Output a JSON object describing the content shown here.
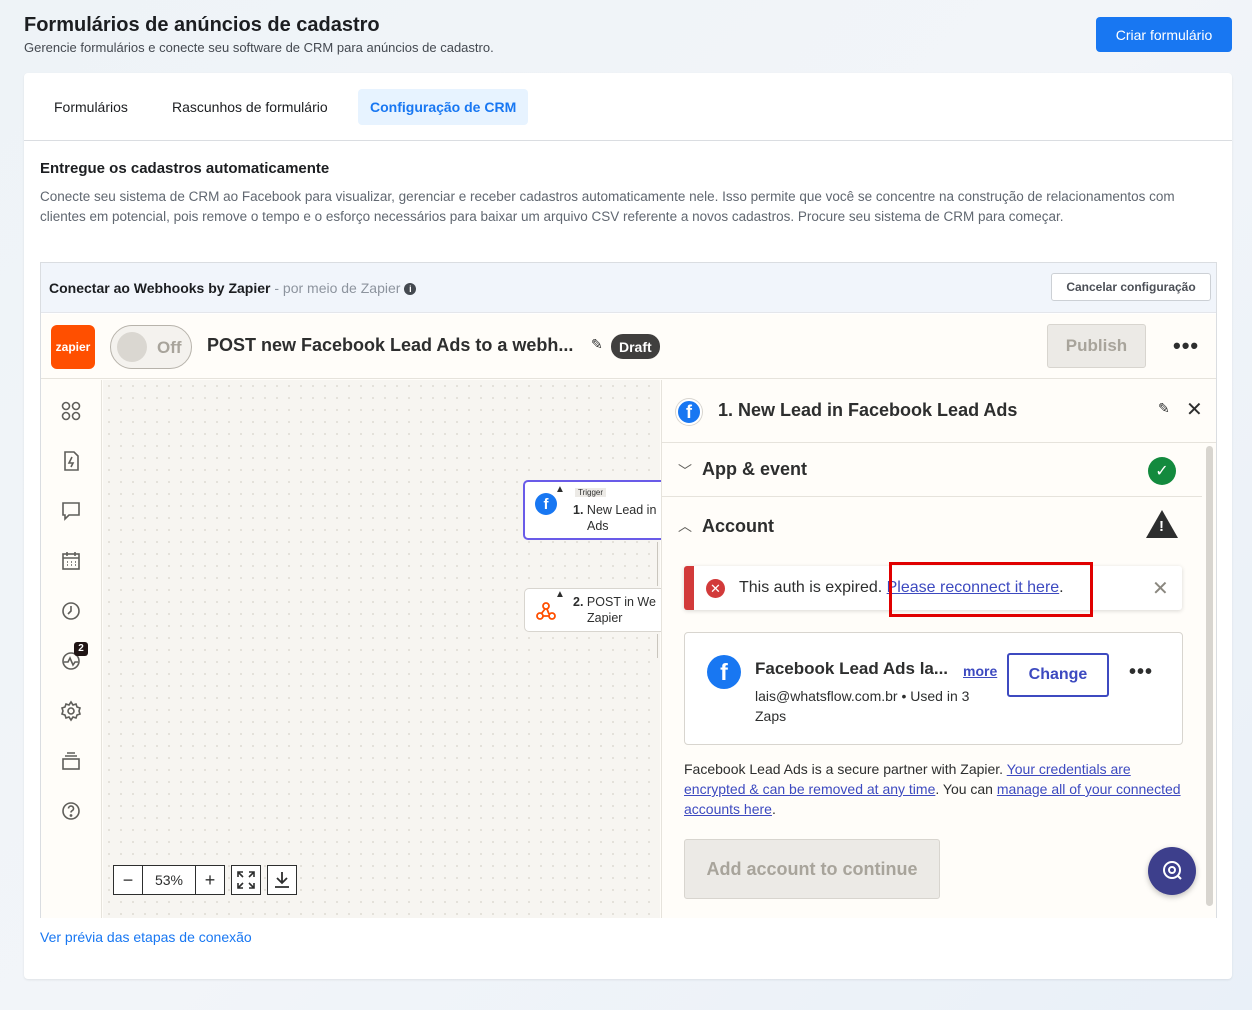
{
  "header": {
    "title": "Formulários de anúncios de cadastro",
    "subtitle": "Gerencie formulários e conecte seu software de CRM para anúncios de cadastro.",
    "create_button": "Criar formulário"
  },
  "tabs": [
    {
      "label": "Formulários"
    },
    {
      "label": "Rascunhos de formulário"
    },
    {
      "label": "Configuração de CRM"
    }
  ],
  "section": {
    "title": "Entregue os cadastros automaticamente",
    "description": "Conecte seu sistema de CRM ao Facebook para visualizar, gerenciar e receber cadastros automaticamente nele. Isso permite que você se concentre na construção de relacionamentos com clientes em potencial, pois remove o tempo e o esforço necessários para baixar um arquivo CSV referente a novos cadastros. Procure seu sistema de CRM para começar."
  },
  "connect": {
    "title": "Conectar ao Webhooks by Zapier",
    "via": " - por meio de Zapier",
    "cancel_button": "Cancelar configuração"
  },
  "zap": {
    "logo": "zapier",
    "toggle_label": "Off",
    "name": "POST new Facebook Lead Ads to a webh...",
    "status_badge": "Draft",
    "publish_button": "Publish",
    "zoom": "53%",
    "activity_badge": "2",
    "node1": {
      "tag": "Trigger",
      "num": "1.",
      "line1": "New Lead in",
      "line2": "Ads"
    },
    "node2": {
      "num": "2.",
      "line1": "POST in We",
      "line2": "Zapier"
    }
  },
  "panel": {
    "title": "1. New Lead in Facebook Lead Ads",
    "step_app_event": "App & event",
    "step_account": "Account",
    "alert_text": "This auth is expired. ",
    "alert_link": "Please reconnect it here",
    "alert_period": ".",
    "account_name": "Facebook Lead Ads la...",
    "account_more": "more",
    "account_email": "lais@whatsflow.com.br • Used in 3 Zaps",
    "change_button": "Change",
    "secure_1": "Facebook Lead Ads is a secure partner with Zapier. ",
    "secure_link1": "Your credentials are encrypted & can be removed at any time",
    "secure_2": ". You can ",
    "secure_link2": "manage all of your connected accounts here",
    "secure_3": ".",
    "add_button": "Add account to continue"
  },
  "footer": {
    "preview_link": "Ver prévia das etapas de conexão"
  },
  "colors": {
    "facebook_blue": "#1877f2",
    "zapier_orange": "#ff4f00",
    "zapier_link": "#3d4ac0",
    "alert_red": "#d23a3a",
    "success_green": "#138a3e"
  }
}
